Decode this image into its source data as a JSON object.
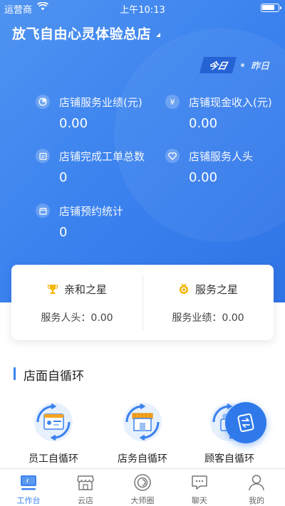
{
  "status_bar": {
    "carrier": "运营商",
    "time": "上午10:13"
  },
  "header": {
    "store_name": "放飞自由心灵体验总店"
  },
  "day_toggle": {
    "today": "今日",
    "yesterday": "昨日",
    "selected": "今日"
  },
  "stats": {
    "service_revenue": {
      "label": "店铺服务业绩(元)",
      "value": "0.00",
      "icon": "pie-chart-icon"
    },
    "cash_income": {
      "label": "店铺现金收入(元)",
      "value": "0.00",
      "icon": "yen-icon"
    },
    "completed_orders": {
      "label": "店铺完成工单总数",
      "value": "0",
      "icon": "order-icon"
    },
    "service_headcount": {
      "label": "店铺服务人头",
      "value": "0.00",
      "icon": "heart-icon"
    },
    "reservations": {
      "label": "店铺预约统计",
      "value": "0",
      "icon": "calendar-icon"
    }
  },
  "stars": {
    "affinity": {
      "title": "亲和之星",
      "metric": "服务人头：0.00",
      "icon": "trophy-icon"
    },
    "service": {
      "title": "服务之星",
      "metric": "服务业绩：0.00",
      "icon": "medal-icon"
    }
  },
  "section": {
    "title": "店面自循环"
  },
  "loops": [
    {
      "label": "员工自循环",
      "icon": "employee-loop-icon"
    },
    {
      "label": "店务自循环",
      "icon": "store-loop-icon"
    },
    {
      "label": "顾客自循环",
      "icon": "customer-loop-icon"
    }
  ],
  "tabs": [
    {
      "label": "工作台",
      "icon": "monitor-icon",
      "active": true
    },
    {
      "label": "云店",
      "icon": "shop-icon",
      "active": false
    },
    {
      "label": "大师圈",
      "icon": "circle-icon",
      "active": false
    },
    {
      "label": "聊天",
      "icon": "chat-icon",
      "active": false
    },
    {
      "label": "我的",
      "icon": "user-icon",
      "active": false
    }
  ],
  "colors": {
    "primary": "#3b82ef",
    "hero_start": "#4f93f0",
    "hero_end": "#2f74e6",
    "today_badge": "#2562d4",
    "tab_inactive": "#666666"
  }
}
